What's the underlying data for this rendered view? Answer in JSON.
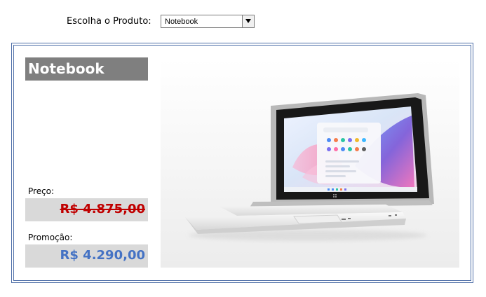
{
  "selector": {
    "label": "Escolha o Produto:",
    "selected_value": "Notebook"
  },
  "product": {
    "name": "Notebook",
    "price_label": "Preço:",
    "price_value": "R$ 4.875,00",
    "promo_label": "Promoção:",
    "promo_value": "R$ 4.290,00"
  },
  "colors": {
    "frame_border": "#4f6fa8",
    "title_background": "#7f7f7f",
    "price_box_background": "#d9d9d9",
    "old_price": "#c00000",
    "promo_price": "#4472c4"
  },
  "icons": {
    "dropdown": "chevron-down-icon"
  }
}
